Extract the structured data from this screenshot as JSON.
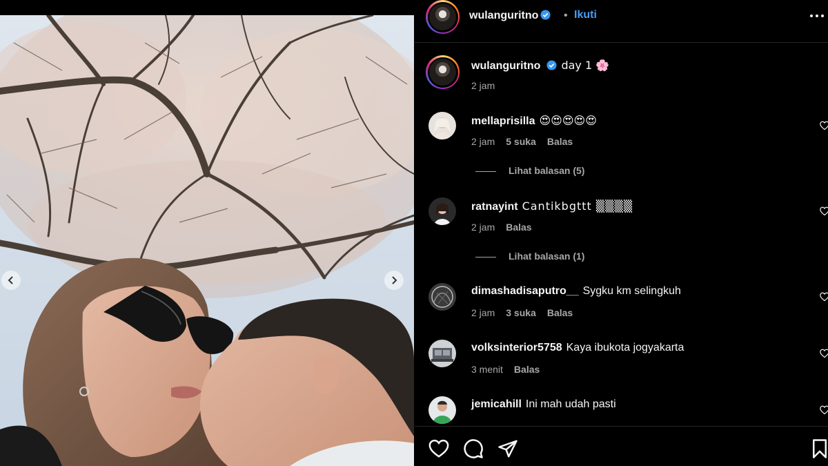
{
  "post": {
    "author": "wulanguritno",
    "follow_label": "Ikuti",
    "separator": "•",
    "caption": "day 1 🌸",
    "caption_time": "2 jam"
  },
  "comments": [
    {
      "user": "mellaprisilla",
      "text": "😍😍😍😍😍",
      "time": "2 jam",
      "likes": "5 suka",
      "reply": "Balas",
      "view_replies": "Lihat balasan (5)"
    },
    {
      "user": "ratnayint",
      "text": "Cantikbgttt ▒▒▒▒",
      "time": "2 jam",
      "likes": "",
      "reply": "Balas",
      "view_replies": "Lihat balasan (1)"
    },
    {
      "user": "dimashadisaputro__",
      "text": "Sygku km selingkuh",
      "time": "2 jam",
      "likes": "3 suka",
      "reply": "Balas",
      "view_replies": ""
    },
    {
      "user": "volksinterior5758",
      "text": "Kaya ibukota jogyakarta",
      "time": "3 menit",
      "likes": "",
      "reply": "Balas",
      "view_replies": ""
    },
    {
      "user": "jemicahill",
      "text": "Ini mah udah pasti",
      "time": "",
      "likes": "",
      "reply": "",
      "view_replies": ""
    }
  ],
  "icons": {
    "verified": "verified-badge-icon",
    "more": "more-options-icon",
    "like": "heart-icon",
    "comment": "comment-icon",
    "share": "share-icon",
    "save": "bookmark-icon",
    "prev": "chevron-left-icon",
    "next": "chevron-right-icon"
  },
  "colors": {
    "background": "#000000",
    "link_blue": "#4a9cf5",
    "verified_blue": "#3897f0",
    "muted_text": "#a8a8a8",
    "divider": "#262626"
  }
}
